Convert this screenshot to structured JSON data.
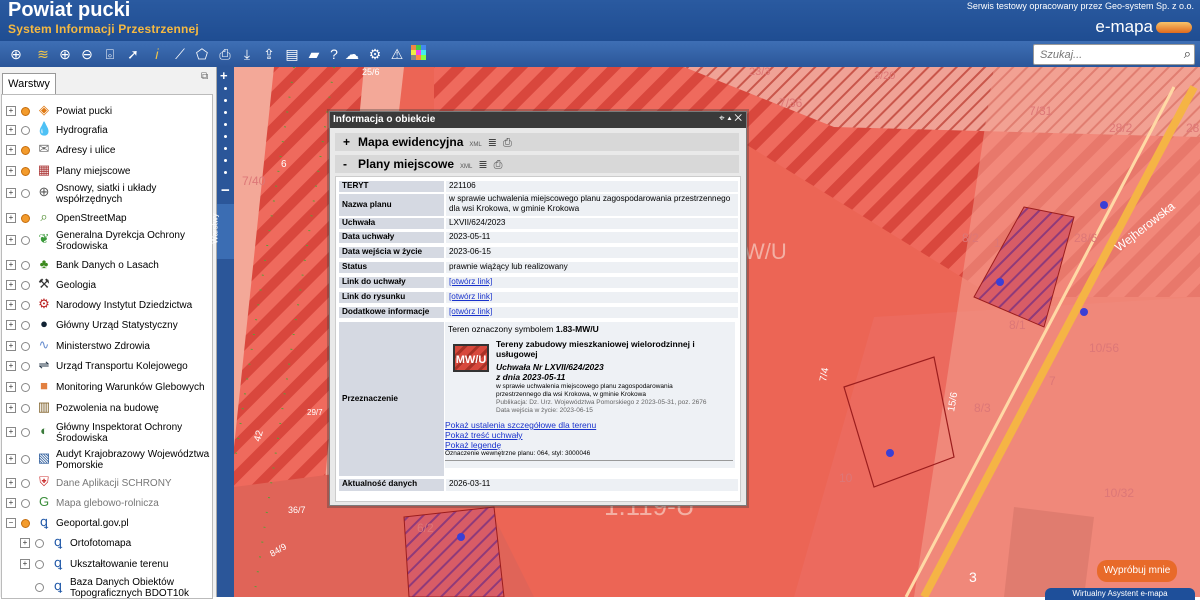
{
  "header": {
    "title": "Powiat pucki",
    "subtitle": "System Informacji Przestrzennej",
    "credit": "Serwis testowy opracowany przez Geo-system Sp. z o.o.",
    "brand": "e-mapa"
  },
  "toolbar": {
    "icons": [
      "globe-icon",
      "layers-icon",
      "zoom-in-icon",
      "zoom-out-icon",
      "zoom-extent-icon",
      "select-arrow-icon",
      "info-icon",
      "measure-line-icon",
      "measure-area-icon",
      "print-icon",
      "download-icon",
      "export-icon",
      "layout-icon",
      "comment-icon",
      "help-icon",
      "cloud-icon",
      "settings-icon",
      "warning-icon",
      "color-grid-icon"
    ],
    "search_placeholder": "Szukaj..."
  },
  "sidebar": {
    "tab_label": "Warstwy",
    "strip_label": "Warstwy",
    "layers": [
      {
        "label": "Powiat pucki",
        "checked": true,
        "icon": "logo-icon"
      },
      {
        "label": "Hydrografia",
        "checked": false,
        "icon": "water-drop-icon"
      },
      {
        "label": "Adresy i ulice",
        "checked": true,
        "icon": "envelope-icon"
      },
      {
        "label": "Plany miejscowe",
        "checked": true,
        "icon": "plan-icon"
      },
      {
        "label": "Osnowy, siatki i układy",
        "label2": "współrzędnych",
        "checked": false,
        "icon": "grid-globe-icon"
      },
      {
        "label": "OpenStreetMap",
        "checked": true,
        "icon": "map-search-icon"
      },
      {
        "label": "Generalna Dyrekcja Ochrony",
        "label2": "Środowiska",
        "checked": false,
        "icon": "leaf-icon"
      },
      {
        "label": "Bank Danych o Lasach",
        "checked": false,
        "icon": "tree-icon"
      },
      {
        "label": "Geologia",
        "checked": false,
        "icon": "hammers-icon"
      },
      {
        "label": "Narodowy Instytut Dziedzictwa",
        "checked": false,
        "icon": "heritage-icon"
      },
      {
        "label": "Główny Urząd Statystyczny",
        "checked": false,
        "icon": "stats-icon"
      },
      {
        "label": "Ministerstwo Zdrowia",
        "checked": false,
        "icon": "health-icon"
      },
      {
        "label": "Urząd Transportu Kolejowego",
        "checked": false,
        "icon": "rail-icon"
      },
      {
        "label": "Monitoring Warunków Glebowych",
        "checked": false,
        "icon": "soil-icon"
      },
      {
        "label": "Pozwolenia na budowę",
        "checked": false,
        "icon": "building-permit-icon"
      },
      {
        "label": "Główny Inspektorat Ochrony",
        "label2": "Środowiska",
        "checked": false,
        "icon": "environment-icon"
      },
      {
        "label": "Audyt Krajobrazowy Województwa",
        "label2": "Pomorskie",
        "checked": false,
        "icon": "landscape-icon"
      },
      {
        "label": "Dane Aplikacji SCHRONY",
        "checked": false,
        "icon": "shield-icon",
        "gray": true
      },
      {
        "label": "Mapa glebowo-rolnicza",
        "checked": false,
        "icon": "g-icon",
        "gray": true
      },
      {
        "label": "Geoportal.gov.pl",
        "checked": true,
        "icon": "geoportal-icon",
        "expanded": true
      },
      {
        "label": "Ortofotomapa",
        "checked": false,
        "icon": "geoportal-icon",
        "indent": true
      },
      {
        "label": "Ukształtowanie terenu",
        "checked": false,
        "icon": "geoportal-icon",
        "indent": true
      },
      {
        "label": "Baza Danych Obiektów",
        "label2": "Topograficznych BDOT10k",
        "checked": false,
        "icon": "geoportal-icon",
        "indent": true,
        "noexpand": true
      }
    ]
  },
  "map": {
    "parcel_labels": [
      "25/6",
      "23/3",
      "3/20",
      "7/36",
      "7/31",
      "28/2",
      "28",
      "7/40",
      "6",
      "8/2",
      "28/6",
      "Wejherowska",
      "4",
      "1",
      "8/1",
      "10/56",
      "7",
      "7/4",
      "15/6",
      "8/3",
      "29/7",
      "42",
      "6/2",
      "10",
      "8/2",
      "10/32",
      "36/7",
      "84/9",
      "1.119-U",
      "49",
      "3"
    ],
    "mwu_label": "W/U",
    "big_label": "1.119-U"
  },
  "popup": {
    "title": "Informacja o obiekcie",
    "section1": {
      "label": "Mapa ewidencyjna",
      "state": "+"
    },
    "section2": {
      "label": "Plany miejscowe",
      "state": "-"
    },
    "xml": "XML",
    "rows": [
      {
        "key": "TERYT",
        "value": "221106"
      },
      {
        "key": "Nazwa planu",
        "value": "w sprawie uchwalenia miejscowego planu zagospodarowania przestrzennego dla wsi Krokowa, w gminie Krokowa"
      },
      {
        "key": "Uchwała",
        "value": "LXVII/624/2023"
      },
      {
        "key": "Data uchwały",
        "value": "2023-05-11"
      },
      {
        "key": "Data wejścia w życie",
        "value": "2023-06-15"
      },
      {
        "key": "Status",
        "value": "prawnie wiążący lub realizowany"
      },
      {
        "key": "Link do uchwały",
        "value": "[otwórz link]"
      },
      {
        "key": "Link do rysunku",
        "value": "[otwórz link]"
      },
      {
        "key": "Dodatkowe informacje",
        "value": "[otwórz link]"
      }
    ],
    "przeznaczenie_key": "Przeznaczenie",
    "przeznaczenie": {
      "intro": "Teren oznaczony symbolem",
      "symbol": "1.83-MW/U",
      "badge": "MW/U",
      "heading": "Tereny zabudowy mieszkaniowej wielorodzinnej i usługowej",
      "uchwala": "Uchwała Nr LXVII/624/2023",
      "z_dnia": "z dnia 2023-05-11",
      "line1": "w sprawie uchwalenia miejscowego planu zagospodarowania",
      "line2": "przestrzennego dla wsi Krokowa, w gminie Krokowa",
      "publikacja": "Publikacja: Dz. Urz. Województwa Pomorskiego z 2023-05-31, poz. 2676",
      "wejscie": "Data wejścia w życie: 2023-06-15",
      "link1": "Pokaż ustalenia szczegółowe dla terenu",
      "link2": "Pokaż treść uchwały",
      "link3": "Pokaż legendę",
      "internal": "Oznaczenie wewnętrzne planu: 064, styl: 3000046"
    },
    "aktualnosc_key": "Aktualność danych",
    "aktualnosc_value": "2026-03-11"
  },
  "buttons": {
    "try": "Wypróbuj mnie",
    "assistant": "Wirtualny Asystent e-mapa"
  }
}
